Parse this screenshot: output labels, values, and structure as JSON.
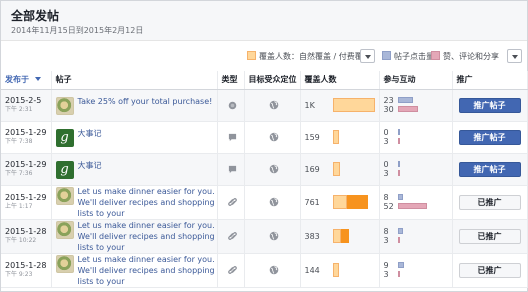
{
  "header": {
    "title": "全部发帖",
    "date_range": "2014年11月15日到2015年2月12日"
  },
  "legend": {
    "reach_label": "覆盖人数：自然覆盖 / 付费覆盖",
    "clicks_label": "帖子点击量",
    "reactions_label": "赞、评论和分享",
    "colors": {
      "organic": "#ffd79a",
      "paid": "#f7931e",
      "clicks": "#a9b7d8",
      "reactions": "#e4a7b7"
    }
  },
  "columns": {
    "published": "发布于",
    "post": "帖子",
    "type": "类型",
    "targeting": "目标受众定位",
    "reach": "覆盖人数",
    "engagement": "参与互动",
    "promote": "推广"
  },
  "rows": [
    {
      "date": "2015-2-5",
      "time": "下午 2:31",
      "thumb": "food",
      "thumb_text": "",
      "text": "Take 25% off your total purchase!",
      "type_icon": "status-icon",
      "reach": 1000,
      "reach_label": "1K",
      "organic_frac": 1.0,
      "paid_frac": 0.0,
      "clicks": 23,
      "reactions": 30,
      "clicks_frac": 0.45,
      "reactions_frac": 0.6,
      "button": "推广帖子",
      "button_style": "primary"
    },
    {
      "date": "2015-1-29",
      "time": "下午 7:38",
      "thumb": "logo",
      "thumb_text": "g",
      "text": "大事记",
      "type_icon": "comment-icon",
      "reach": 159,
      "reach_label": "159",
      "organic_frac": 0.15,
      "paid_frac": 0.0,
      "clicks": 0,
      "reactions": 3,
      "clicks_frac": 0.0,
      "reactions_frac": 0.06,
      "button": "推广帖子",
      "button_style": "primary"
    },
    {
      "date": "2015-1-29",
      "time": "下午 7:36",
      "thumb": "logo",
      "thumb_text": "g",
      "text": "大事记",
      "type_icon": "comment-icon",
      "reach": 169,
      "reach_label": "169",
      "organic_frac": 0.16,
      "paid_frac": 0.0,
      "clicks": 0,
      "reactions": 3,
      "clicks_frac": 0.0,
      "reactions_frac": 0.06,
      "button": "推广帖子",
      "button_style": "primary"
    },
    {
      "date": "2015-1-29",
      "time": "上午 1:17",
      "thumb": "food",
      "thumb_text": "",
      "text": "Let us make dinner easier for you. We'll deliver recipes and shopping lists to your",
      "type_icon": "link-icon",
      "reach": 761,
      "reach_label": "761",
      "organic_frac": 0.33,
      "paid_frac": 0.5,
      "clicks": 8,
      "reactions": 52,
      "clicks_frac": 0.16,
      "reactions_frac": 0.85,
      "button": "已推广",
      "button_style": "secondary"
    },
    {
      "date": "2015-1-28",
      "time": "下午 10:22",
      "thumb": "food",
      "thumb_text": "",
      "text": "Let us make dinner easier for you. We'll deliver recipes and shopping lists to your",
      "type_icon": "link-icon",
      "reach": 383,
      "reach_label": "383",
      "organic_frac": 0.18,
      "paid_frac": 0.18,
      "clicks": 8,
      "reactions": 3,
      "clicks_frac": 0.16,
      "reactions_frac": 0.06,
      "button": "已推广",
      "button_style": "secondary"
    },
    {
      "date": "2015-1-28",
      "time": "下午 9:23",
      "thumb": "food",
      "thumb_text": "",
      "text": "Let us make dinner easier for you. We'll deliver recipes and shopping lists to your",
      "type_icon": "link-icon",
      "reach": 144,
      "reach_label": "144",
      "organic_frac": 0.14,
      "paid_frac": 0.0,
      "clicks": 9,
      "reactions": 3,
      "clicks_frac": 0.18,
      "reactions_frac": 0.06,
      "button": "已推广",
      "button_style": "secondary"
    }
  ]
}
